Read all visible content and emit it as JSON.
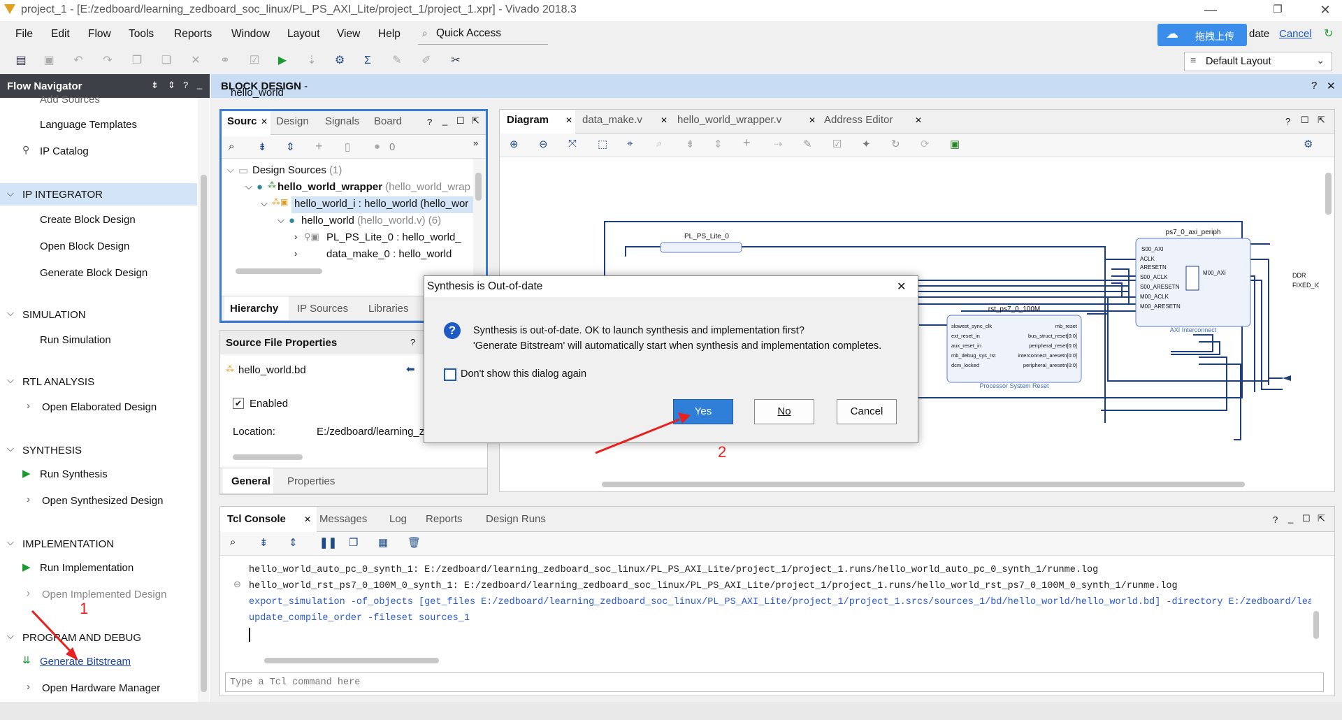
{
  "window": {
    "title": "project_1 - [E:/zedboard/learning_zedboard_soc_linux/PL_PS_AXI_Lite/project_1/project_1.xpr] - Vivado 2018.3"
  },
  "menu": [
    "File",
    "Edit",
    "Flow",
    "Tools",
    "Reports",
    "Window",
    "Layout",
    "View",
    "Help"
  ],
  "quick_access": "Quick Access",
  "baidu": {
    "label": "拖拽上传",
    "update_suffix": "date",
    "cancel": "Cancel"
  },
  "layout_select": "Default Layout",
  "flow_nav": {
    "title": "Flow Navigator",
    "cut_item": "Add Sources",
    "items": {
      "lang_templates": "Language Templates",
      "ip_catalog": "IP Catalog",
      "ip_integrator": "IP INTEGRATOR",
      "create_bd": "Create Block Design",
      "open_bd": "Open Block Design",
      "gen_bd": "Generate Block Design",
      "simulation": "SIMULATION",
      "run_sim": "Run Simulation",
      "rtl": "RTL ANALYSIS",
      "open_elab": "Open Elaborated Design",
      "synthesis": "SYNTHESIS",
      "run_synth": "Run Synthesis",
      "open_synth": "Open Synthesized Design",
      "impl": "IMPLEMENTATION",
      "run_impl": "Run Implementation",
      "open_impl": "Open Implemented Design",
      "prog": "PROGRAM AND DEBUG",
      "gen_bit": "Generate Bitstream",
      "open_hw": "Open Hardware Manager"
    }
  },
  "block_design": {
    "label": "BLOCK DESIGN",
    "name": "hello_world"
  },
  "sources": {
    "tabs": [
      "Sourc",
      "Design",
      "Signals",
      "Board"
    ],
    "count": "0",
    "tree": {
      "root": "Design Sources",
      "root_count": "(1)",
      "wrapper": "hello_world_wrapper",
      "wrapper_tail": "(hello_world_wrap",
      "inst": "hello_world_i : hello_world (hello_wor",
      "hw": "hello_world",
      "hw_tail": "(hello_world.v) (6)",
      "plps": "PL_PS_Lite_0 : hello_world_",
      "dm": "data_make_0 : hello_world"
    },
    "bottom_tabs": [
      "Hierarchy",
      "IP Sources",
      "Libraries"
    ]
  },
  "props": {
    "title": "Source File Properties",
    "file": "hello_world.bd",
    "enabled": "Enabled",
    "location_label": "Location:",
    "location_value": "E:/zedboard/learning_ze",
    "tabs": [
      "General",
      "Properties"
    ]
  },
  "diagram": {
    "tabs": [
      "Diagram",
      "data_make.v",
      "hello_world_wrapper.v",
      "Address Editor"
    ],
    "blocks": {
      "periph_title": "ps7_0_axi_periph",
      "periph_ports": [
        "S00_AXI",
        "ACLK",
        "ARESETN",
        "S00_ACLK",
        "S00_ARESETN",
        "M00_ACLK",
        "M00_ARESETN"
      ],
      "periph_out": "M00_AXI",
      "periph_caption": "AXI Interconnect",
      "pl_title": "PL_PS_Lite_0",
      "rst_title": "rst_ps7_0_100M",
      "rst_in": [
        "slowest_sync_clk",
        "ext_reset_in",
        "aux_reset_in",
        "mb_debug_sys_rst",
        "dcm_locked"
      ],
      "rst_out": [
        "mb_reset",
        "bus_struct_reset[0:0]",
        "peripheral_reset[0:0]",
        "interconnect_aresetn[0:0]",
        "peripheral_aresetn[0:0]"
      ],
      "rst_caption": "Processor System Reset",
      "ext_ports": [
        "DDR",
        "FIXED_IO"
      ]
    }
  },
  "dialog": {
    "title": "Synthesis is Out-of-date",
    "line1": "Synthesis is out-of-date. OK to launch synthesis and implementation first?",
    "line2": "'Generate Bitstream' will automatically start when synthesis and implementation completes.",
    "checkbox": "Don't show this dialog again",
    "yes": "Yes",
    "no": "No",
    "cancel": "Cancel"
  },
  "console": {
    "tabs": [
      "Tcl Console",
      "Messages",
      "Log",
      "Reports",
      "Design Runs"
    ],
    "lines": [
      "hello_world_auto_pc_0_synth_1: E:/zedboard/learning_zedboard_soc_linux/PL_PS_AXI_Lite/project_1/project_1.runs/hello_world_auto_pc_0_synth_1/runme.log",
      "hello_world_rst_ps7_0_100M_0_synth_1: E:/zedboard/learning_zedboard_soc_linux/PL_PS_AXI_Lite/project_1/project_1.runs/hello_world_rst_ps7_0_100M_0_synth_1/runme.log",
      "export_simulation -of_objects [get_files E:/zedboard/learning_zedboard_soc_linux/PL_PS_AXI_Lite/project_1/project_1.srcs/sources_1/bd/hello_world/hello_world.bd] -directory E:/zedboard/learn",
      "update_compile_order -fileset sources_1"
    ],
    "placeholder": "Type a Tcl command here"
  },
  "annotations": {
    "one": "1",
    "two": "2"
  },
  "colors": {
    "accent": "#3a7bd5",
    "annotation": "#e82020",
    "yes_button": "#2f7fd8"
  }
}
